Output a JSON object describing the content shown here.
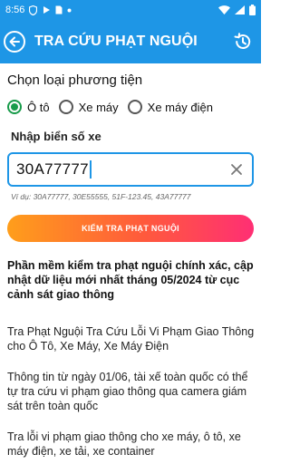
{
  "status_bar": {
    "time": "8:56",
    "colors": {
      "bar": "#1e96e6"
    }
  },
  "app_bar": {
    "title": "TRA CỨU PHẠT NGUỘI",
    "back_icon": "back-arrow-icon",
    "history_icon": "history-icon"
  },
  "vehicle_section": {
    "title": "Chọn loại phương tiện",
    "options": [
      {
        "label": "Ô tô",
        "selected": true
      },
      {
        "label": "Xe máy",
        "selected": false
      },
      {
        "label": "Xe máy điện",
        "selected": false
      }
    ]
  },
  "plate": {
    "label": "Nhập biển số xe",
    "value": "30A77777",
    "example": "Ví dụ: 30A77777, 30E55555, 51F-123.45, 43A77777"
  },
  "search_button": {
    "label": "KIỂM TRA PHẠT NGUỘI"
  },
  "content": {
    "intro": "Phần mềm kiểm tra phạt nguội chính xác, cập nhật dữ liệu mới nhất tháng 05/2024 từ cục cảnh sát giao thông",
    "paragraph1": "Tra Phạt Nguội Tra Cứu Lỗi Vi Phạm Giao Thông cho Ô Tô, Xe Máy, Xe Máy Điện",
    "paragraph2": "Thông tin từ ngày 01/06, tài xế toàn quốc có thể tự tra cứu vi phạm giao thông qua camera giám sát trên toàn quốc",
    "paragraph3": "Tra lỗi vi phạm giao thông cho xe máy, ô tô, xe máy điện, xe tải, xe container"
  },
  "colors": {
    "primary": "#1e96e6",
    "radio_selected": "#189b4a",
    "button_gradient": [
      "#ff9e1b",
      "#ff2f74"
    ]
  }
}
